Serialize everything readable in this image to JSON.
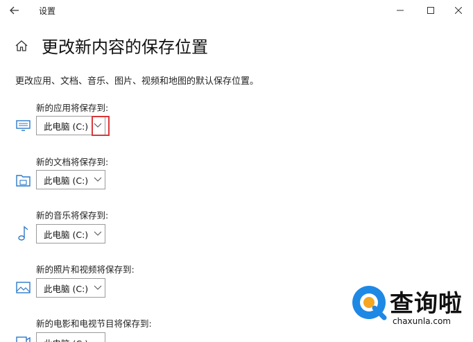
{
  "window": {
    "title": "设置",
    "back_label": "←",
    "minimize_label": "—",
    "maximize_label": "☐",
    "close_label": "✕"
  },
  "page": {
    "title": "更改新内容的保存位置",
    "description": "更改应用、文档、音乐、图片、视频和地图的默认保存位置。"
  },
  "sections": [
    {
      "label": "新的应用将保存到:",
      "icon": "monitor-icon",
      "value": "此电脑 (C:)"
    },
    {
      "label": "新的文档将保存到:",
      "icon": "folder-icon",
      "value": "此电脑 (C:)"
    },
    {
      "label": "新的音乐将保存到:",
      "icon": "music-note-icon",
      "value": "此电脑 (C:)"
    },
    {
      "label": "新的照片和视频将保存到:",
      "icon": "picture-icon",
      "value": "此电脑 (C:)"
    },
    {
      "label": "新的电影和电视节目将保存到:",
      "icon": "video-icon",
      "value": "此电脑 (C:)"
    }
  ],
  "watermark": {
    "brand": "查询啦",
    "domain": "chaxunla.com"
  },
  "colors": {
    "accent_blue": "#2b79c9",
    "highlight_red": "#d9383a",
    "watermark_blue": "#1e88e5",
    "watermark_orange": "#f5a623"
  }
}
